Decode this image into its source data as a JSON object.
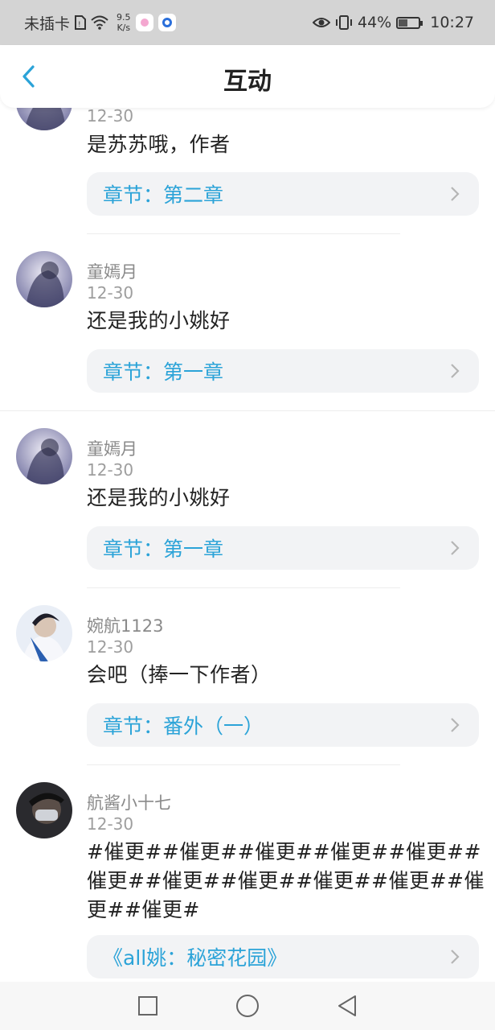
{
  "status_bar": {
    "carrier": "未插卡",
    "speed_value": "9.5",
    "speed_unit": "K/s",
    "battery_percent": "44%",
    "battery_level": 0.44,
    "time": "10:27"
  },
  "header": {
    "title": "互动"
  },
  "comments": [
    {
      "name": "",
      "date": "12-30",
      "text": "是苏苏哦，作者",
      "chapter": "章节：第二章"
    },
    {
      "name": "童嫣月",
      "date": "12-30",
      "text": "还是我的小姚好",
      "chapter": "章节：第一章"
    },
    {
      "name": "童嫣月",
      "date": "12-30",
      "text": "还是我的小姚好",
      "chapter": "章节：第一章"
    },
    {
      "name": "婉航1123",
      "date": "12-30",
      "text": "会吧（捧一下作者）",
      "chapter": "章节：番外（一）"
    },
    {
      "name": "航酱小十七",
      "date": "12-30",
      "text": "#催更##催更##催更##催更##催更##催更##催更##催更##催更##催更##催更##催更#",
      "chapter": "《all姚：秘密花园》"
    }
  ],
  "colors": {
    "accent": "#2ba3d8",
    "status_bar_bg": "#d4d4d4"
  }
}
